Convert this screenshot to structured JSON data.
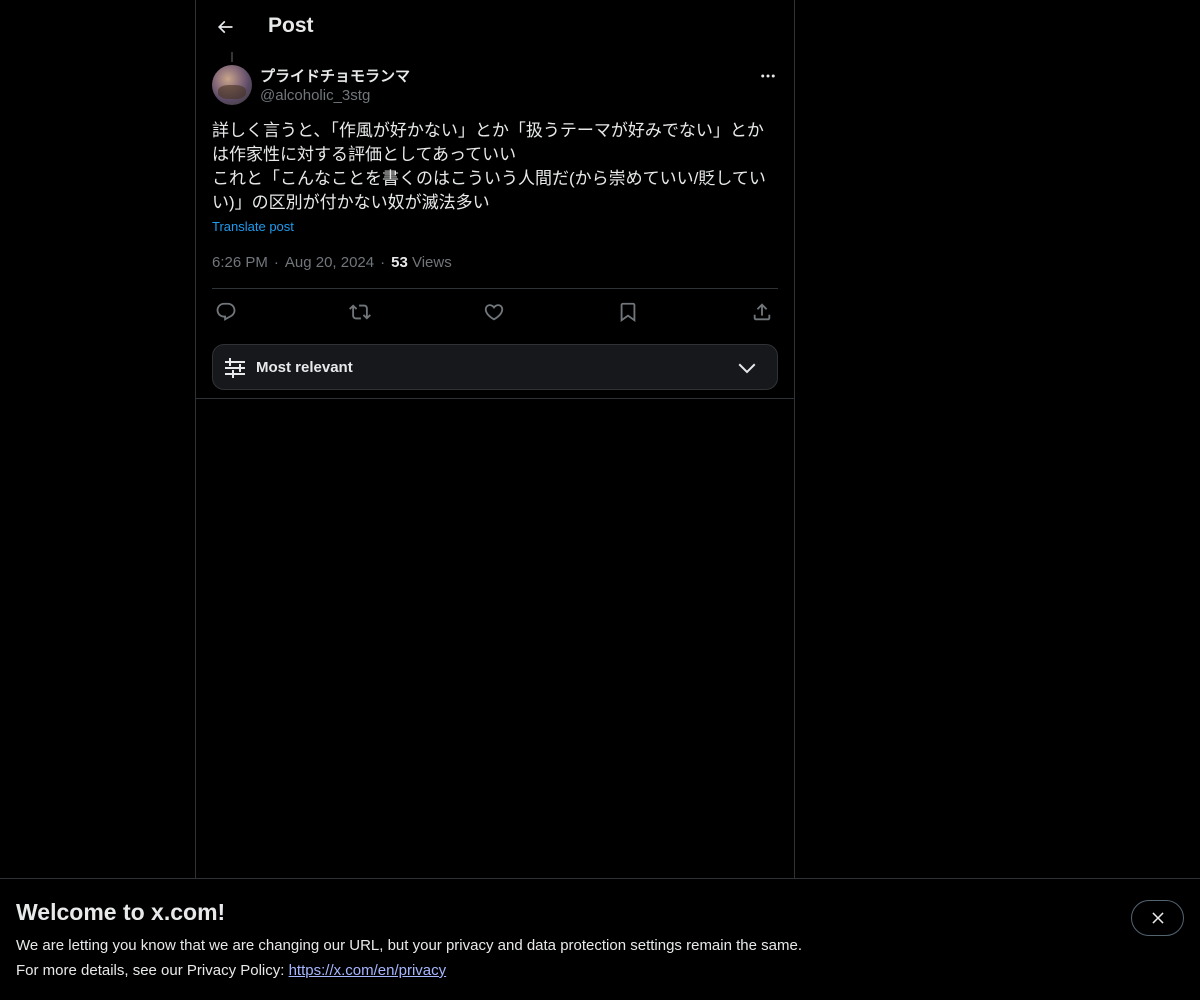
{
  "header": {
    "title": "Post"
  },
  "post": {
    "display_name": "プライドチョモランマ",
    "handle": "@alcoholic_3stg",
    "text_lines": [
      "詳しく言うと、「作風が好かない」とか「扱うテーマが好みでない」とか",
      "は作家性に対する評価としてあっていい",
      "これと「こんなことを書くのはこういう人間だ(から崇めていい/貶してい",
      "い)」の区別が付かない奴が滅法多い"
    ],
    "translate_label": "Translate post",
    "time": "6:26 PM",
    "date": "Aug 20, 2024",
    "views_count": "53",
    "views_label": "Views",
    "separator": "·"
  },
  "actions": {
    "icons": [
      "reply-icon",
      "repost-icon",
      "like-icon",
      "bookmark-icon",
      "share-icon"
    ]
  },
  "sort": {
    "label": "Most relevant"
  },
  "banner": {
    "title": "Welcome to x.com!",
    "line1": "We are letting you know that we are changing our URL, but your privacy and data protection settings remain the same.",
    "line2_prefix": "For more details, see our Privacy Policy: ",
    "link": "https://x.com/en/privacy"
  },
  "colors": {
    "background": "#000000",
    "text": "#e7e9ea",
    "muted": "#71767b",
    "accent": "#1d9bf0",
    "border": "#2f3336",
    "link": "#a6b6ff"
  }
}
